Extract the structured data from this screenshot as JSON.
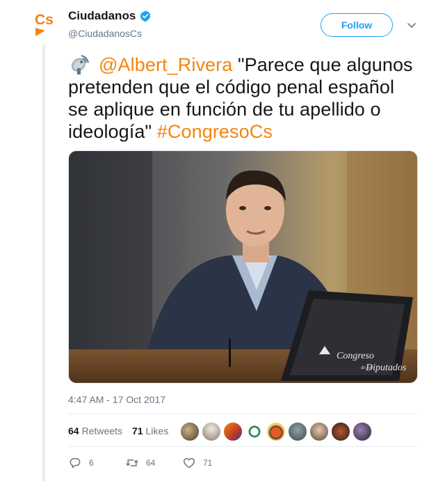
{
  "author": {
    "display_name": "Ciudadanos",
    "handle": "@CiudadanosCs",
    "logo_text": "Cs"
  },
  "follow_label": "Follow",
  "tweet": {
    "emoji": "satellite-antenna",
    "mention": "@Albert_Rivera",
    "body": " \"Parece que algunos pretenden que el código penal español se aplique en función de tu apellido o ideología\" ",
    "hashtag": "#CongresoCs"
  },
  "media": {
    "sign_line1": "Congreso",
    "sign_line2": "de los",
    "sign_line3": "Diputados"
  },
  "timestamp": "4:47 AM - 17 Oct 2017",
  "stats": {
    "retweets_count": "64",
    "retweets_label": "Retweets",
    "likes_count": "71",
    "likes_label": "Likes"
  },
  "actions": {
    "reply_count": "6",
    "retweet_count": "64",
    "like_count": "71"
  },
  "colors": {
    "brand_orange": "#f4840f",
    "twitter_blue": "#1da1f2",
    "muted_gray": "#657786"
  }
}
